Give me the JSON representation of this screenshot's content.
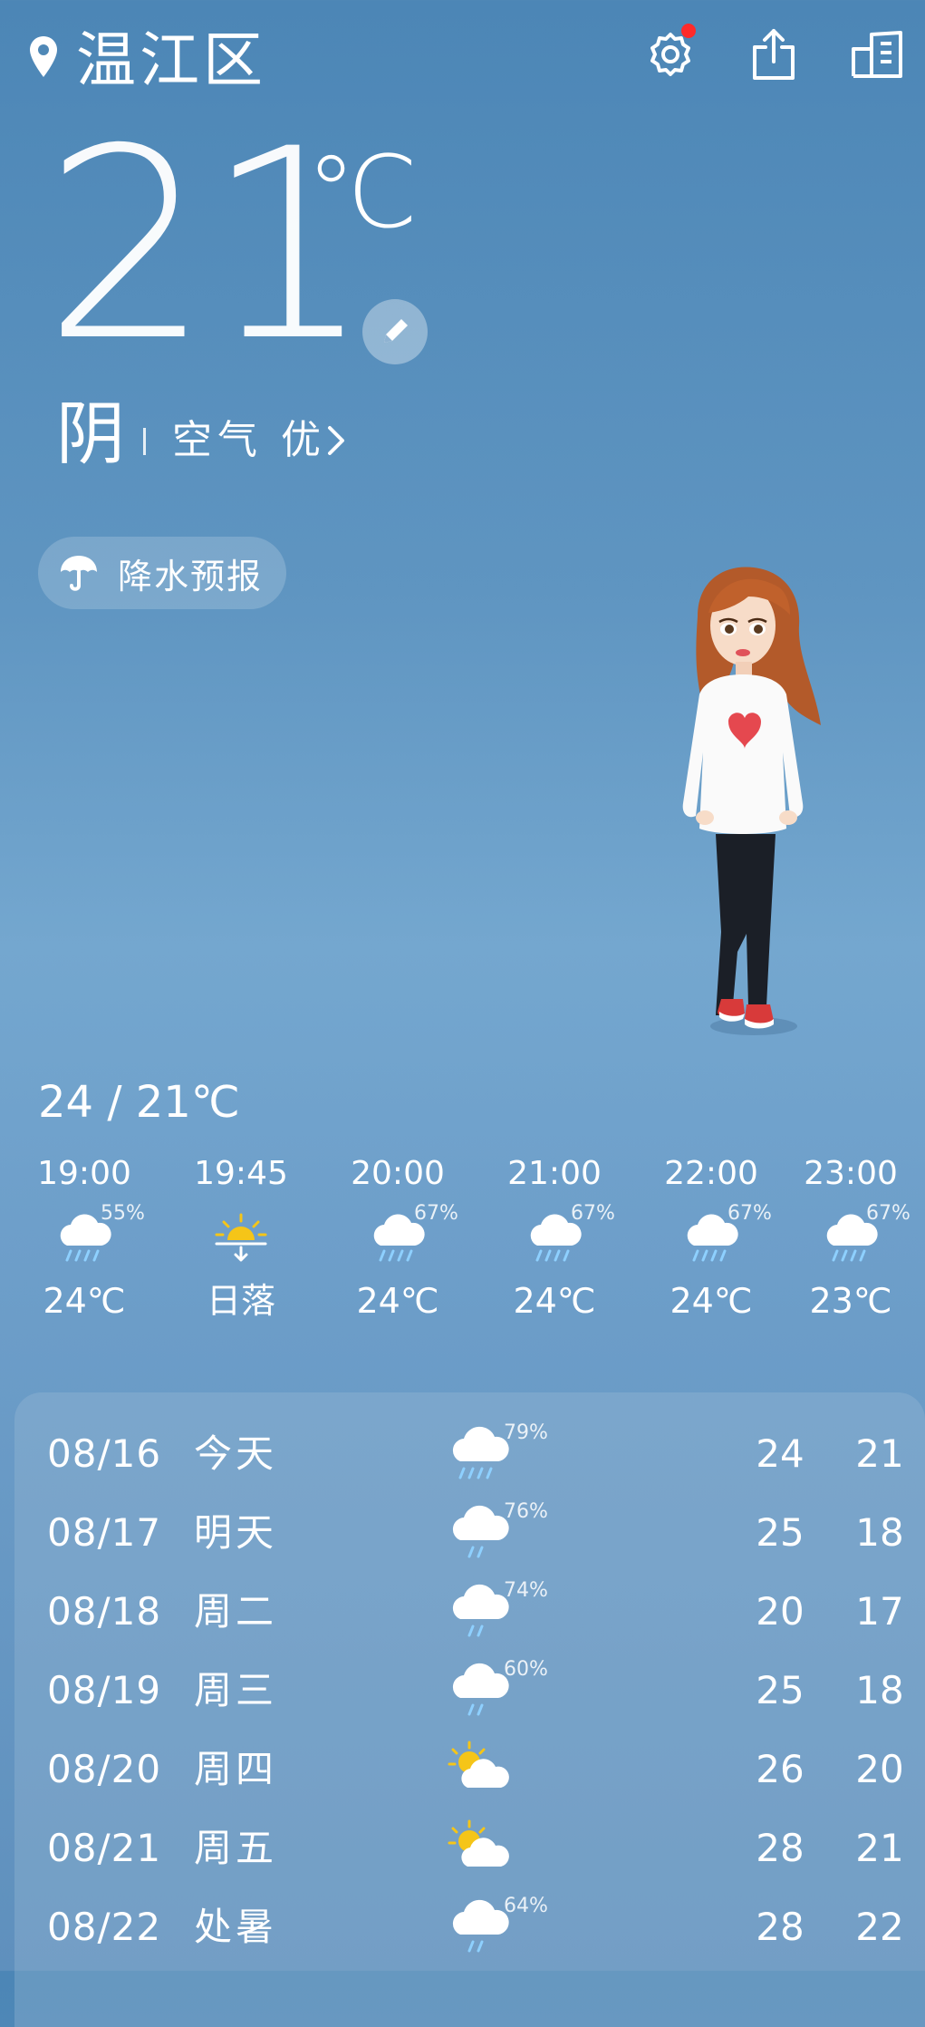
{
  "header": {
    "location": "温江区",
    "icons": [
      "location-pin-icon",
      "settings-icon",
      "share-icon",
      "city-list-icon"
    ],
    "settings_badge_color": "#ff2a2a"
  },
  "current": {
    "temperature": "21",
    "unit": "℃",
    "condition": "阴",
    "air_quality": "空气 优"
  },
  "precip_button": {
    "label": "降水预报"
  },
  "today_range": "24 / 21℃",
  "hourly": [
    {
      "time": "19:00",
      "icon": "rain-cloud-icon",
      "pct": "55%",
      "value": "24℃"
    },
    {
      "time": "19:45",
      "icon": "sunset-icon",
      "pct": "",
      "value": "日落"
    },
    {
      "time": "20:00",
      "icon": "rain-cloud-icon",
      "pct": "67%",
      "value": "24℃"
    },
    {
      "time": "21:00",
      "icon": "rain-cloud-icon",
      "pct": "67%",
      "value": "24℃"
    },
    {
      "time": "22:00",
      "icon": "rain-cloud-icon",
      "pct": "67%",
      "value": "24℃"
    },
    {
      "time": "23:00",
      "icon": "rain-cloud-icon",
      "pct": "67%",
      "value": "23℃"
    }
  ],
  "daily": [
    {
      "date": "08/16",
      "day": "今天",
      "icon": "heavy-rain-cloud-icon",
      "pct": "79%",
      "high": "24",
      "low": "21"
    },
    {
      "date": "08/17",
      "day": "明天",
      "icon": "light-rain-cloud-icon",
      "pct": "76%",
      "high": "25",
      "low": "18"
    },
    {
      "date": "08/18",
      "day": "周二",
      "icon": "light-rain-cloud-icon",
      "pct": "74%",
      "high": "20",
      "low": "17"
    },
    {
      "date": "08/19",
      "day": "周三",
      "icon": "light-rain-cloud-icon",
      "pct": "60%",
      "high": "25",
      "low": "18"
    },
    {
      "date": "08/20",
      "day": "周四",
      "icon": "partly-cloudy-icon",
      "pct": "",
      "high": "26",
      "low": "20"
    },
    {
      "date": "08/21",
      "day": "周五",
      "icon": "partly-cloudy-icon",
      "pct": "",
      "high": "28",
      "low": "21"
    },
    {
      "date": "08/22",
      "day": "处暑",
      "icon": "light-rain-cloud-icon",
      "pct": "64%",
      "high": "28",
      "low": "22"
    }
  ]
}
